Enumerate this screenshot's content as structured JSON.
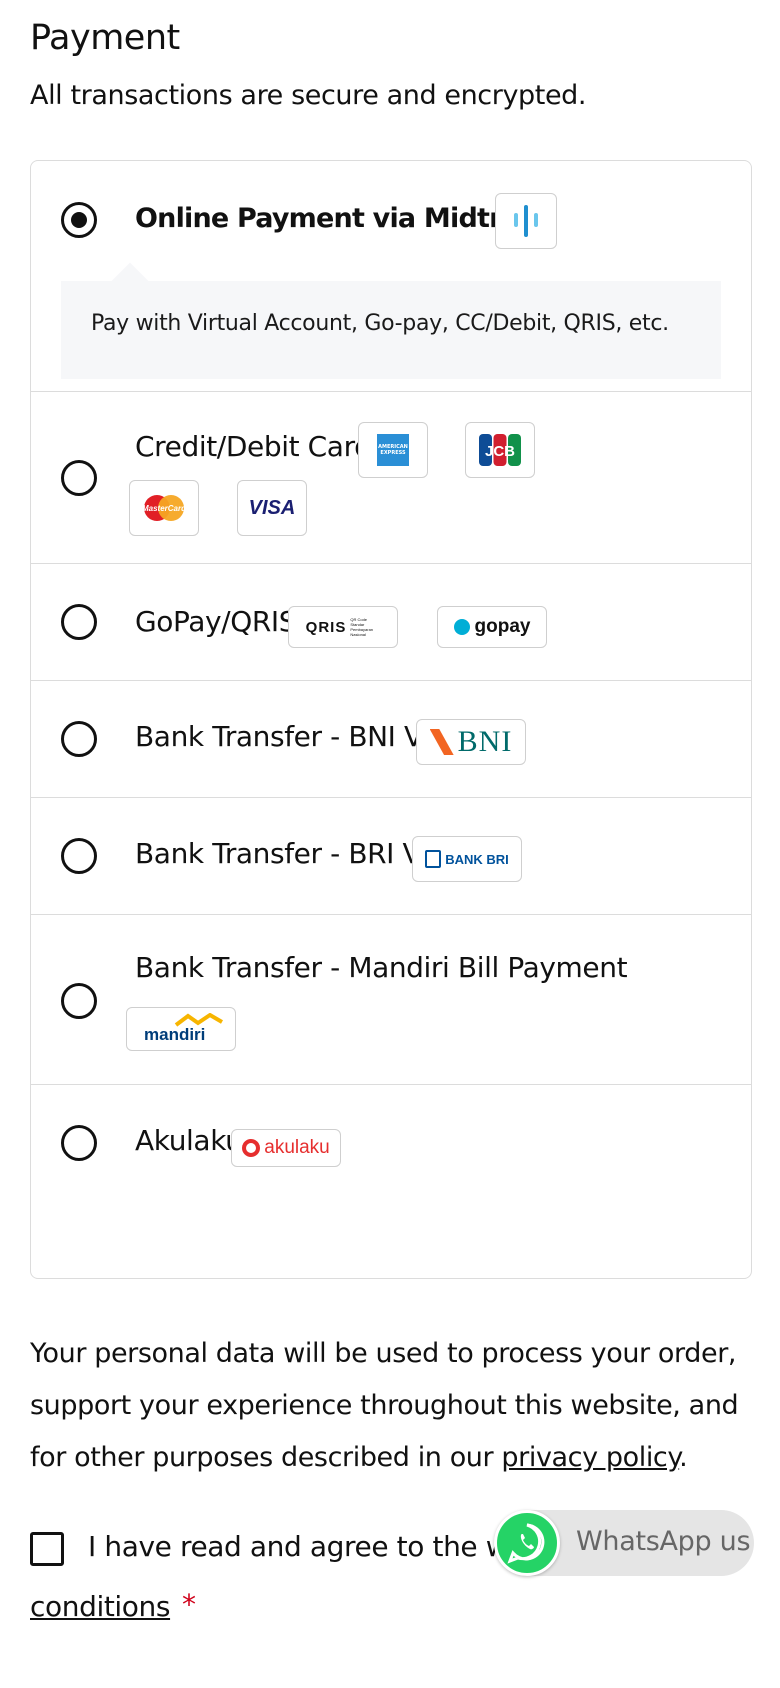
{
  "header": {
    "title": "Payment",
    "subtitle": "All transactions are secure and encrypted."
  },
  "methods": [
    {
      "label": "Online Payment via Midtrans",
      "selected": true,
      "description": "Pay with Virtual Account, Go-pay, CC/Debit, QRIS, etc.",
      "logo": "midtrans-logo"
    },
    {
      "label": "Credit/Debit Card",
      "selected": false,
      "logos": [
        "amex-logo",
        "jcb-logo",
        "mastercard-logo",
        "visa-logo"
      ]
    },
    {
      "label": "GoPay/QRIS",
      "selected": false,
      "logos": [
        "qris-logo",
        "gopay-logo"
      ]
    },
    {
      "label": "Bank Transfer - BNI VA",
      "selected": false,
      "logos": [
        "bni-logo"
      ]
    },
    {
      "label": "Bank Transfer - BRI VA",
      "selected": false,
      "logos": [
        "bri-logo"
      ]
    },
    {
      "label": "Bank Transfer - Mandiri Bill Payment",
      "selected": false,
      "logos": [
        "mandiri-logo"
      ]
    },
    {
      "label": "Akulaku",
      "selected": false,
      "logos": [
        "akulaku-logo"
      ]
    }
  ],
  "logo_text": {
    "amex": "AMERICAN EXPRESS",
    "jcb": "JCB",
    "mastercard": "MasterCard",
    "visa": "VISA",
    "qris": "QRIS",
    "qris_sub": "QR Code Standar Pembayaran Nasional",
    "gopay": "gopay",
    "bni": "BNI",
    "bri": "BANK BRI",
    "mandiri": "mandiri",
    "akulaku": "akulaku"
  },
  "notice": {
    "text_before": "Your personal data will be used to process your order, support your experience throughout this website, and for other purposes described in our ",
    "link": "privacy policy",
    "text_after": "."
  },
  "agree": {
    "text": "I have read and agree to the we",
    "text_line2": "conditions",
    "required_mark": "*"
  },
  "whatsapp": {
    "label": "WhatsApp us"
  },
  "colors": {
    "border": "#dcdcdc",
    "desc_bg": "#f6f7f9",
    "whatsapp_green": "#25d366",
    "required_red": "#d0021b"
  }
}
